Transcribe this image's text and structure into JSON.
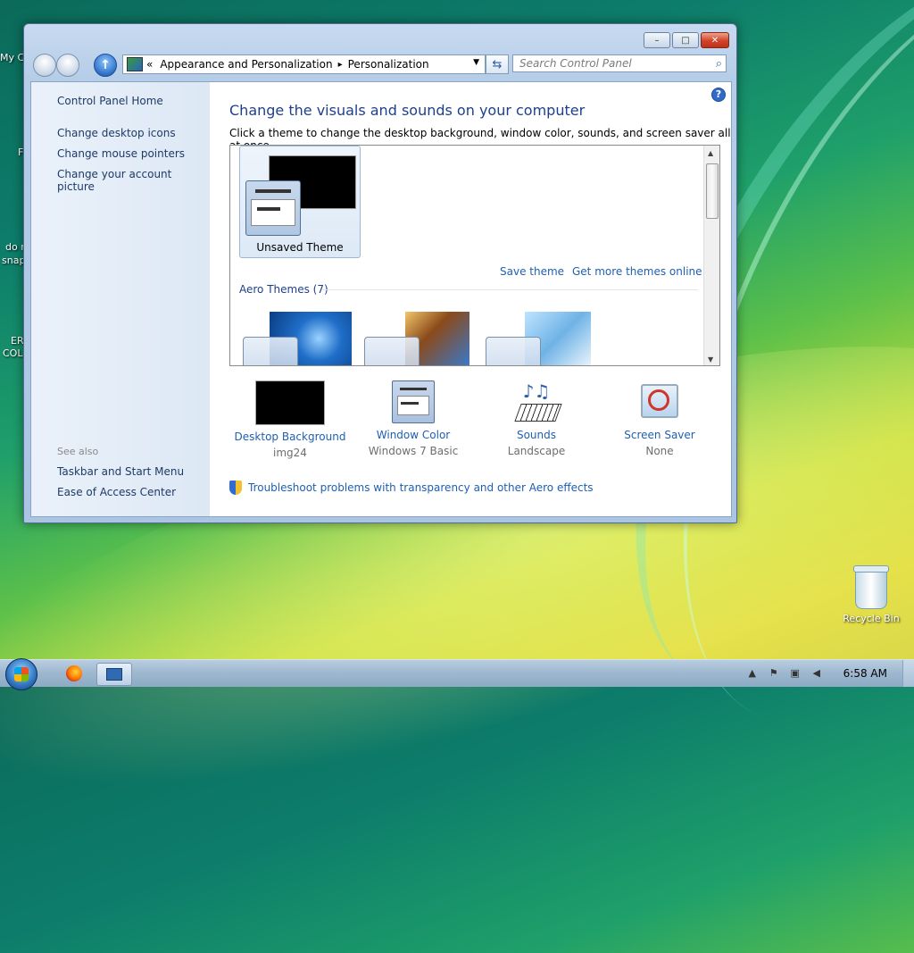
{
  "desktop": {
    "partial_labels": [
      "My C",
      "F",
      "do n",
      "snap",
      "ER",
      "COL"
    ],
    "recycle_bin_label": "Recycle Bin"
  },
  "window": {
    "caption": {
      "minimize": "–",
      "maximize": "□",
      "close": "✕"
    },
    "breadcrumb": {
      "prefix": "«",
      "items": [
        "Appearance and Personalization",
        "Personalization"
      ],
      "separator": "▸"
    },
    "search_placeholder": "Search Control Panel",
    "left_pane": {
      "home": "Control Panel Home",
      "links": [
        "Change desktop icons",
        "Change mouse pointers",
        "Change your account picture"
      ],
      "see_also_label": "See also",
      "see_also": [
        "Taskbar and Start Menu",
        "Ease of Access Center"
      ]
    },
    "main": {
      "heading": "Change the visuals and sounds on your computer",
      "subtext": "Click a theme to change the desktop background, window color, sounds, and screen saver all at once.",
      "unsaved_theme": "Unsaved Theme",
      "save_theme": "Save theme",
      "get_more_themes": "Get more themes online",
      "aero_themes": "Aero Themes (7)",
      "settings": [
        {
          "name": "Desktop Background",
          "value": "img24"
        },
        {
          "name": "Window Color",
          "value": "Windows 7 Basic"
        },
        {
          "name": "Sounds",
          "value": "Landscape"
        },
        {
          "name": "Screen Saver",
          "value": "None"
        }
      ],
      "troubleshoot": "Troubleshoot problems with transparency and other Aero effects"
    }
  },
  "taskbar": {
    "clock": "6:58 AM"
  },
  "colors": {
    "link": "#1f5fb0",
    "heading": "#1e3f8f",
    "close_button": "#d0442a"
  }
}
